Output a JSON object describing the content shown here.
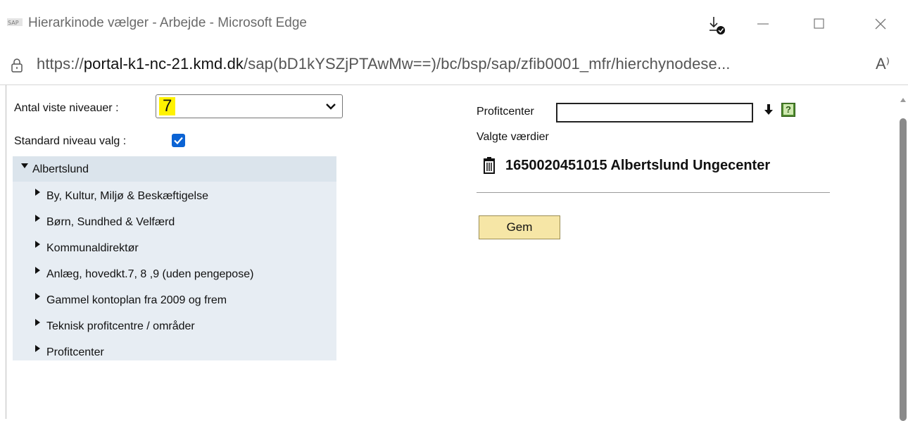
{
  "window": {
    "title": "Hierarkinode vælger - Arbejde - Microsoft Edge",
    "app_icon": "sap-logo-icon",
    "buttons": [
      "download-icon",
      "minimize-icon",
      "maximize-icon",
      "close-icon"
    ]
  },
  "address_bar": {
    "url_prefix": "https://",
    "url_domain": "portal-k1-nc-21.kmd.dk",
    "url_path": "/sap(bD1kYSZjPTAwMw==)/bc/bsp/sap/zfib0001_mfr/hierchynodese...",
    "read_aloud": "A⁾"
  },
  "left_panel": {
    "levels_label": "Antal viste niveauer :",
    "levels_value": "7",
    "standard_label": "Standard niveau valg :",
    "standard_checked": true,
    "tree": {
      "root": "Albertslund",
      "children": [
        "By, Kultur, Miljø & Beskæftigelse",
        "Børn, Sundhed & Velfærd",
        "Kommunaldirektør",
        "Anlæg, hovedkt.7, 8 ,9 (uden pengepose)",
        "Gammel kontoplan fra 2009 og frem",
        "Teknisk profitcentre / områder",
        "Profitcenter"
      ]
    }
  },
  "right_panel": {
    "profitcenter_label": "Profitcenter",
    "profitcenter_value": "",
    "help_glyph": "?",
    "selected_label": "Valgte værdier",
    "selected_items": [
      "1650020451015 Albertslund Ungecenter"
    ],
    "save_label": "Gem"
  },
  "colors": {
    "highlight": "#fff200",
    "checkbox": "#0b63d4",
    "tree_bg": "#e7edf3",
    "button_bg": "#f6e6a6"
  }
}
